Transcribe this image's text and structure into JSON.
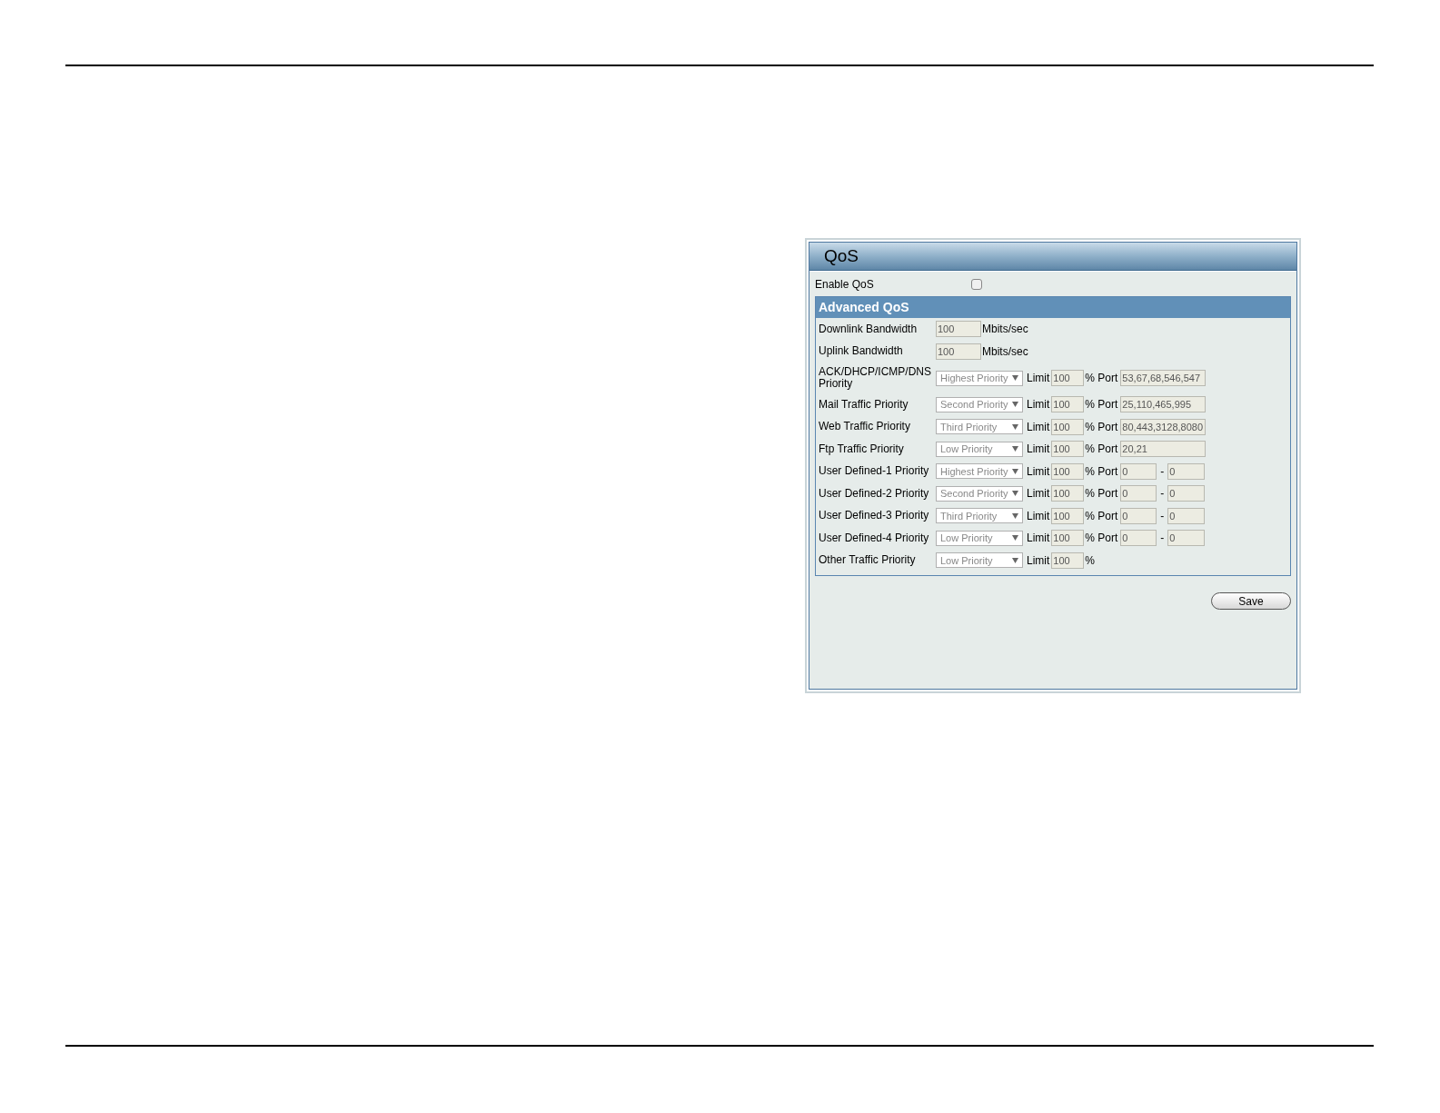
{
  "panel": {
    "title": "QoS",
    "enable": {
      "label": "Enable QoS",
      "checked": false
    },
    "section": {
      "title": "Advanced QoS",
      "rows": [
        {
          "kind": "bandwidth",
          "label": "Downlink Bandwidth",
          "value": "100",
          "unit": "Mbits/sec"
        },
        {
          "kind": "bandwidth",
          "label": "Uplink Bandwidth",
          "value": "100",
          "unit": "Mbits/sec"
        },
        {
          "kind": "port_list",
          "label": "ACK/DHCP/ICMP/DNS Priority",
          "priority": "Highest Priority",
          "limit_label": "Limit",
          "limit": "100",
          "port_label": "% Port",
          "port": "53,67,68,546,547"
        },
        {
          "kind": "port_list",
          "label": "Mail Traffic Priority",
          "priority": "Second Priority",
          "limit_label": "Limit",
          "limit": "100",
          "port_label": "% Port",
          "port": "25,110,465,995"
        },
        {
          "kind": "port_list",
          "label": "Web Traffic Priority",
          "priority": "Third Priority",
          "limit_label": "Limit",
          "limit": "100",
          "port_label": "% Port",
          "port": "80,443,3128,8080"
        },
        {
          "kind": "port_list",
          "label": "Ftp Traffic Priority",
          "priority": "Low Priority",
          "limit_label": "Limit",
          "limit": "100",
          "port_label": "% Port",
          "port": "20,21"
        },
        {
          "kind": "port_range",
          "label": "User Defined-1 Priority",
          "priority": "Highest Priority",
          "limit_label": "Limit",
          "limit": "100",
          "port_label": "% Port",
          "port_from": "0",
          "dash": "-",
          "port_to": "0"
        },
        {
          "kind": "port_range",
          "label": "User Defined-2 Priority",
          "priority": "Second Priority",
          "limit_label": "Limit",
          "limit": "100",
          "port_label": "% Port",
          "port_from": "0",
          "dash": "-",
          "port_to": "0"
        },
        {
          "kind": "port_range",
          "label": "User Defined-3 Priority",
          "priority": "Third Priority",
          "limit_label": "Limit",
          "limit": "100",
          "port_label": "% Port",
          "port_from": "0",
          "dash": "-",
          "port_to": "0"
        },
        {
          "kind": "port_range",
          "label": "User Defined-4 Priority",
          "priority": "Low Priority",
          "limit_label": "Limit",
          "limit": "100",
          "port_label": "% Port",
          "port_from": "0",
          "dash": "-",
          "port_to": "0"
        },
        {
          "kind": "limit_only",
          "label": "Other Traffic Priority",
          "priority": "Low Priority",
          "limit_label": "Limit",
          "limit": "100",
          "port_label": "%"
        }
      ]
    },
    "save": "Save"
  }
}
